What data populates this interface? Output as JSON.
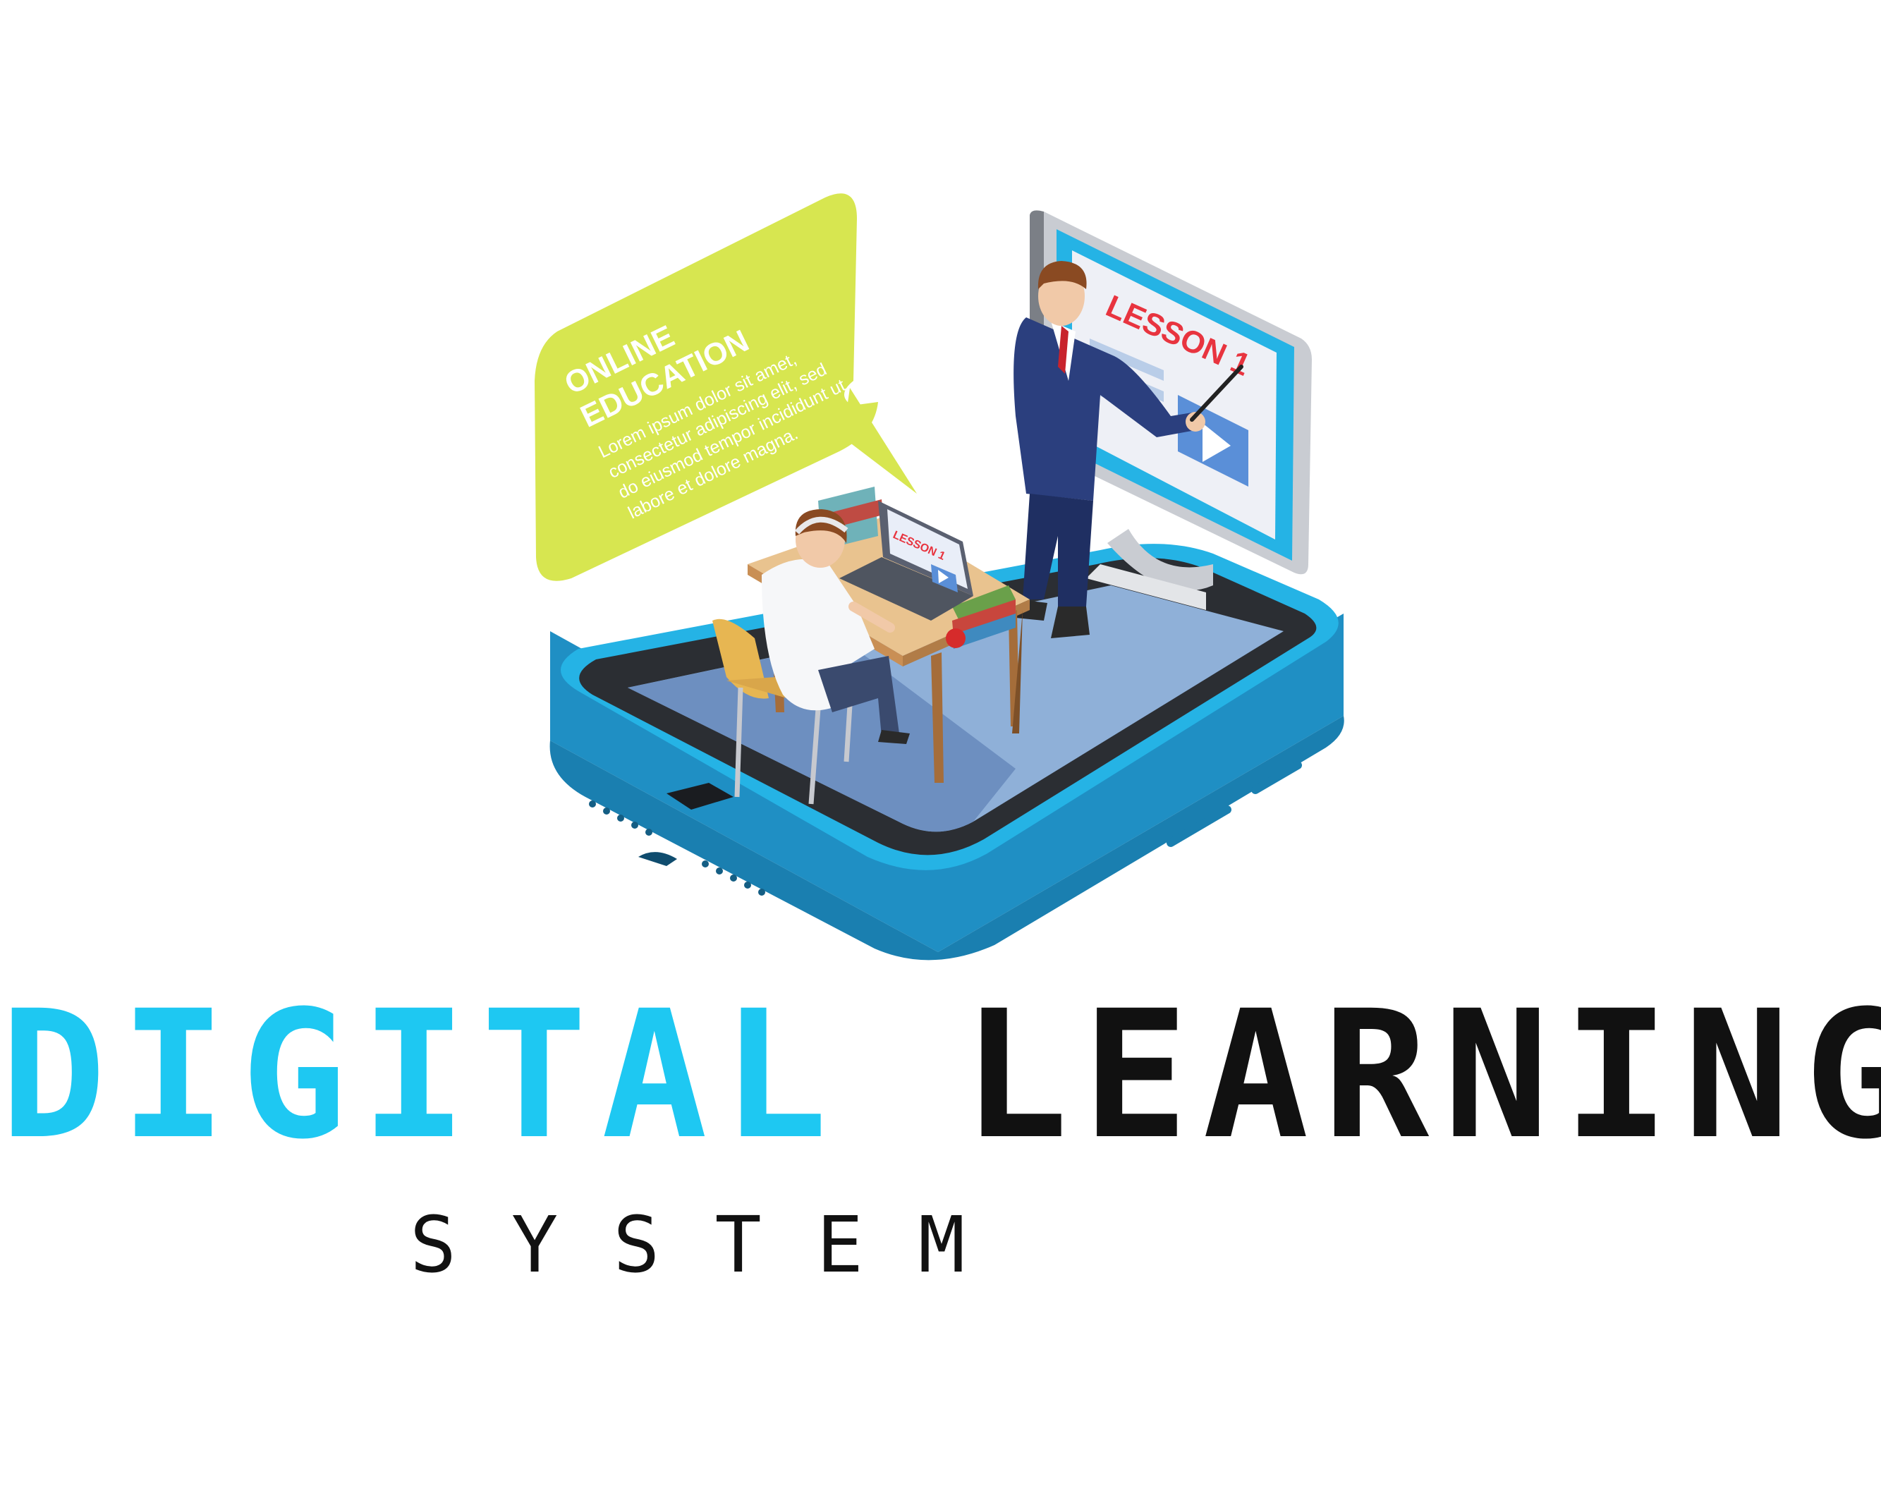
{
  "bubble": {
    "heading_line1": "ONLINE",
    "heading_line2": "EDUCATION",
    "body_lines": [
      "Lorem ipsum dolor sit amet,",
      "consectetur adipiscing elit, sed",
      "do eiusmod tempor incididunt ut",
      "labore et dolore magna."
    ]
  },
  "monitor": {
    "lesson_label": "LESSON 1"
  },
  "laptop": {
    "lesson_label": "LESSON 1"
  },
  "title": {
    "word1": "DIGITAL",
    "word2": "LEARNING"
  },
  "subtitle": "SYSTEM",
  "colors": {
    "accent_cyan": "#1ec8f2",
    "bubble_green": "#d7e650",
    "phone_blue": "#25b3e5",
    "text_dark": "#111111",
    "lesson_red": "#e8343f"
  }
}
